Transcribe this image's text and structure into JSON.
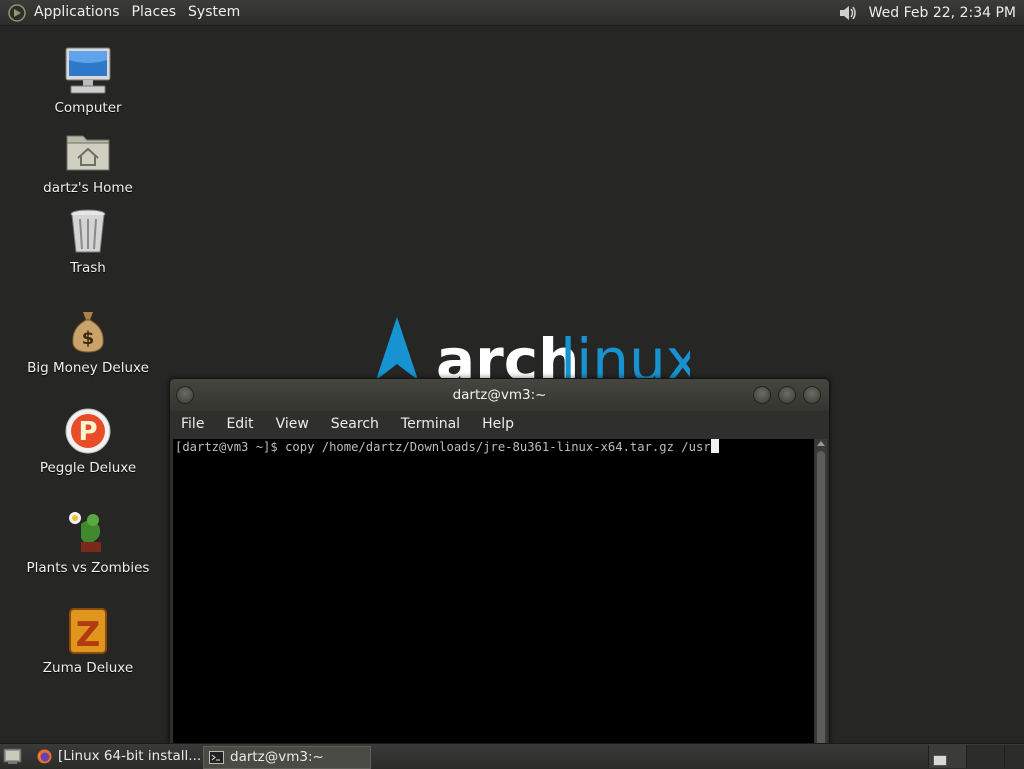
{
  "top_panel": {
    "menus": [
      "Applications",
      "Places",
      "System"
    ],
    "clock": "Wed Feb 22,  2:34 PM"
  },
  "desktop_icons": [
    {
      "label": "Computer",
      "icon": "computer-icon"
    },
    {
      "label": "dartz's Home",
      "icon": "home-folder-icon"
    },
    {
      "label": "Trash",
      "icon": "trash-icon"
    },
    {
      "label": "Big Money Deluxe",
      "icon": "money-bag-icon"
    },
    {
      "label": "Peggle Deluxe",
      "icon": "peggle-icon"
    },
    {
      "label": "Plants vs Zombies",
      "icon": "plants-vs-zombies-icon"
    },
    {
      "label": "Zuma Deluxe",
      "icon": "zuma-icon"
    }
  ],
  "wallpaper": {
    "logo_word_1": "arch",
    "logo_word_2": "linux",
    "accent": "#1793d1"
  },
  "terminal": {
    "title": "dartz@vm3:~",
    "menus": [
      "File",
      "Edit",
      "View",
      "Search",
      "Terminal",
      "Help"
    ],
    "prompt": "[dartz@vm3 ~]$ ",
    "command": "copy /home/dartz/Downloads/jre-8u361-linux-x64.tar.gz /usr"
  },
  "taskbar": {
    "tasks": [
      {
        "label": "[Linux 64-bit install...",
        "icon": "firefox-icon"
      },
      {
        "label": "dartz@vm3:~",
        "icon": "terminal-icon"
      }
    ]
  }
}
